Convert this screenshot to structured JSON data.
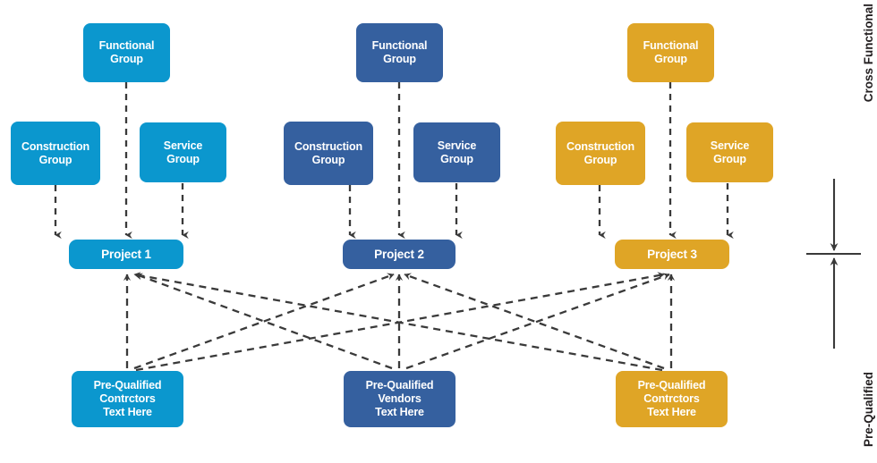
{
  "diagram": {
    "title": "Cross Functional Owner's Project Group and Pre-Qualified External Agencies",
    "colors": {
      "light_blue": "#0b97ce",
      "dark_blue": "#35609f",
      "gold": "#dfa526",
      "connector": "#3a3a3a",
      "text_dark": "#231f20",
      "background": "#ffffff"
    }
  },
  "columns": [
    {
      "id": "column-1",
      "color": "#0b97ce",
      "functional_group": "Functional\nGroup",
      "construction_group": "Construction\nGroup",
      "service_group": "Service\nGroup",
      "project": "Project 1",
      "agency": "Pre-Qualified\nContrctors\nText Here"
    },
    {
      "id": "column-2",
      "color": "#35609f",
      "functional_group": "Functional\nGroup",
      "construction_group": "Construction\nGroup",
      "service_group": "Service\nGroup",
      "project": "Project 2",
      "agency": "Pre-Qualified\nVendors\nText Here"
    },
    {
      "id": "column-3",
      "color": "#dfa526",
      "functional_group": "Functional\nGroup",
      "construction_group": "Construction\nGroup",
      "service_group": "Service\nGroup",
      "project": "Project 3",
      "agency": "Pre-Qualified\nContrctors\nText Here"
    }
  ],
  "side_annotations": {
    "top": "Cross Functional\nOwner's Project\nGroup",
    "bottom": "Pre-Qualified\nExternal Agencies"
  }
}
